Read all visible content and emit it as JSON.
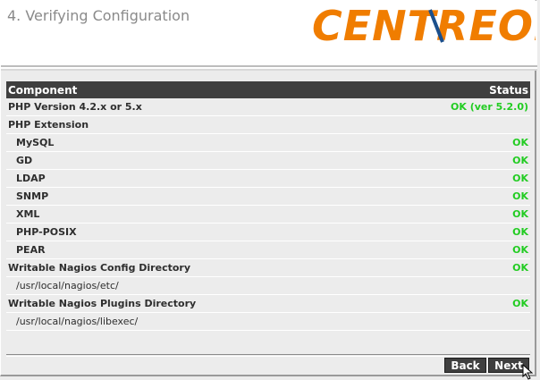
{
  "header": {
    "title": "4. Verifying Configuration",
    "logo_text": "CENTREON"
  },
  "colors": {
    "logo_orange": "#f07d00",
    "logo_blue": "#1b4f8c",
    "ok_green": "#22cc22",
    "table_header_bg": "#3f3f3f"
  },
  "table": {
    "headers": {
      "component": "Component",
      "status": "Status"
    },
    "rows": [
      {
        "label": "PHP Version 4.2.x or 5.x",
        "status": "OK (ver 5.2.0)",
        "kind": "main"
      },
      {
        "label": "PHP Extension",
        "status": "",
        "kind": "main"
      },
      {
        "label": "MySQL",
        "status": "OK",
        "kind": "indent"
      },
      {
        "label": "GD",
        "status": "OK",
        "kind": "indent"
      },
      {
        "label": "LDAP",
        "status": "OK",
        "kind": "indent"
      },
      {
        "label": "SNMP",
        "status": "OK",
        "kind": "indent"
      },
      {
        "label": "XML",
        "status": "OK",
        "kind": "indent"
      },
      {
        "label": "PHP-POSIX",
        "status": "OK",
        "kind": "indent"
      },
      {
        "label": "PEAR",
        "status": "OK",
        "kind": "indent"
      },
      {
        "label": "Writable Nagios Config Directory",
        "status": "OK",
        "kind": "main"
      },
      {
        "label": "/usr/local/nagios/etc/",
        "status": "",
        "kind": "path"
      },
      {
        "label": "Writable Nagios Plugins Directory",
        "status": "OK",
        "kind": "main"
      },
      {
        "label": "/usr/local/nagios/libexec/",
        "status": "",
        "kind": "path"
      }
    ]
  },
  "buttons": {
    "back": "Back",
    "next": "Next"
  }
}
